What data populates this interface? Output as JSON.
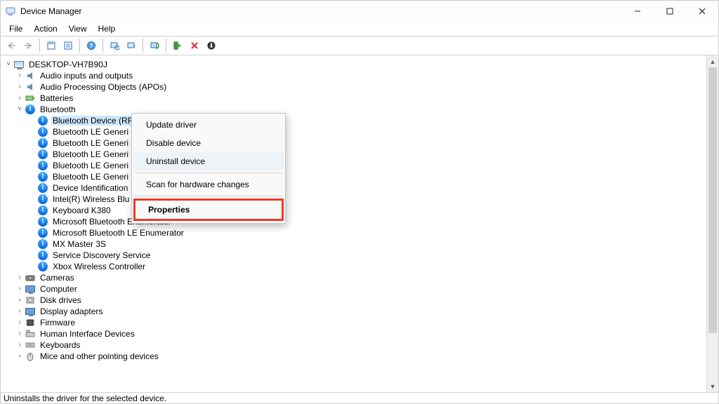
{
  "window": {
    "title": "Device Manager"
  },
  "menubar": [
    "File",
    "Action",
    "View",
    "Help"
  ],
  "statusbar": "Uninstalls the driver for the selected device.",
  "tree": {
    "root": {
      "label": "DESKTOP-VH7B90J",
      "expanded": true
    },
    "categories": [
      {
        "label": "Audio inputs and outputs",
        "icon": "audio",
        "expanded": false
      },
      {
        "label": "Audio Processing Objects (APOs)",
        "icon": "audio",
        "expanded": false
      },
      {
        "label": "Batteries",
        "icon": "battery",
        "expanded": false
      },
      {
        "label": "Bluetooth",
        "icon": "bt",
        "expanded": true,
        "children": [
          {
            "label": "Bluetooth Device (RFCOMM Protocol TDI)",
            "icon": "bt",
            "selected": true
          },
          {
            "label": "Bluetooth LE Generi",
            "icon": "bt"
          },
          {
            "label": "Bluetooth LE Generi",
            "icon": "bt"
          },
          {
            "label": "Bluetooth LE Generi",
            "icon": "bt"
          },
          {
            "label": "Bluetooth LE Generi",
            "icon": "bt"
          },
          {
            "label": "Bluetooth LE Generi",
            "icon": "bt"
          },
          {
            "label": "Device Identification",
            "icon": "bt"
          },
          {
            "label": "Intel(R) Wireless Blu",
            "icon": "bt"
          },
          {
            "label": "Keyboard K380",
            "icon": "bt"
          },
          {
            "label": "Microsoft Bluetooth Enumerator",
            "icon": "bt"
          },
          {
            "label": "Microsoft Bluetooth LE Enumerator",
            "icon": "bt"
          },
          {
            "label": "MX Master 3S",
            "icon": "bt"
          },
          {
            "label": "Service Discovery Service",
            "icon": "bt"
          },
          {
            "label": "Xbox Wireless Controller",
            "icon": "bt"
          }
        ]
      },
      {
        "label": "Cameras",
        "icon": "camera",
        "expanded": false
      },
      {
        "label": "Computer",
        "icon": "monitor",
        "expanded": false
      },
      {
        "label": "Disk drives",
        "icon": "disk",
        "expanded": false
      },
      {
        "label": "Display adapters",
        "icon": "monitor",
        "expanded": false
      },
      {
        "label": "Firmware",
        "icon": "chip",
        "expanded": false
      },
      {
        "label": "Human Interface Devices",
        "icon": "hid",
        "expanded": false
      },
      {
        "label": "Keyboards",
        "icon": "keyboard",
        "expanded": false
      },
      {
        "label": "Mice and other pointing devices",
        "icon": "mouse",
        "expanded": false
      }
    ]
  },
  "contextmenu": {
    "items": [
      {
        "label": "Update driver",
        "type": "item"
      },
      {
        "label": "Disable device",
        "type": "item"
      },
      {
        "label": "Uninstall device",
        "type": "item",
        "hover": true
      },
      {
        "type": "sep"
      },
      {
        "label": "Scan for hardware changes",
        "type": "item"
      },
      {
        "type": "sep"
      },
      {
        "label": "Properties",
        "type": "item",
        "highlighted": true
      }
    ]
  }
}
